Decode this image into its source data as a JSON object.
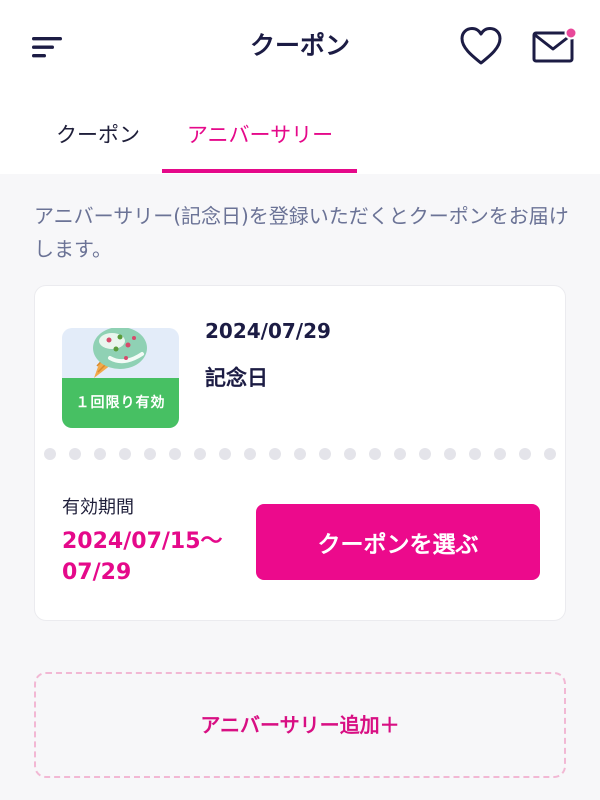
{
  "header": {
    "title": "クーポン",
    "menu_icon": "hamburger-menu-icon",
    "favorite_icon": "heart-icon",
    "mail_icon": "mail-icon",
    "notification_color": "#e8489a"
  },
  "tabs": [
    {
      "label": "クーポン",
      "active": false
    },
    {
      "label": "アニバーサリー",
      "active": true
    }
  ],
  "description": "アニバーサリー(記念日)を登録いただくとクーポンをお届けします。",
  "coupon": {
    "thumbnail_badge": "１回限り有効",
    "date": "2024/07/29",
    "name": "記念日",
    "validity_label": "有効期間",
    "validity_period": "2024/07/15〜07/29",
    "button_label": "クーポンを選ぶ"
  },
  "add_anniversary_label": "アニバーサリー追加＋",
  "colors": {
    "accent": "#e5098a",
    "button": "#ec0a8c",
    "badge_green": "#47c063",
    "text_dark": "#1c1c44",
    "text_muted": "#6b7396",
    "background": "#f7f7f9"
  }
}
